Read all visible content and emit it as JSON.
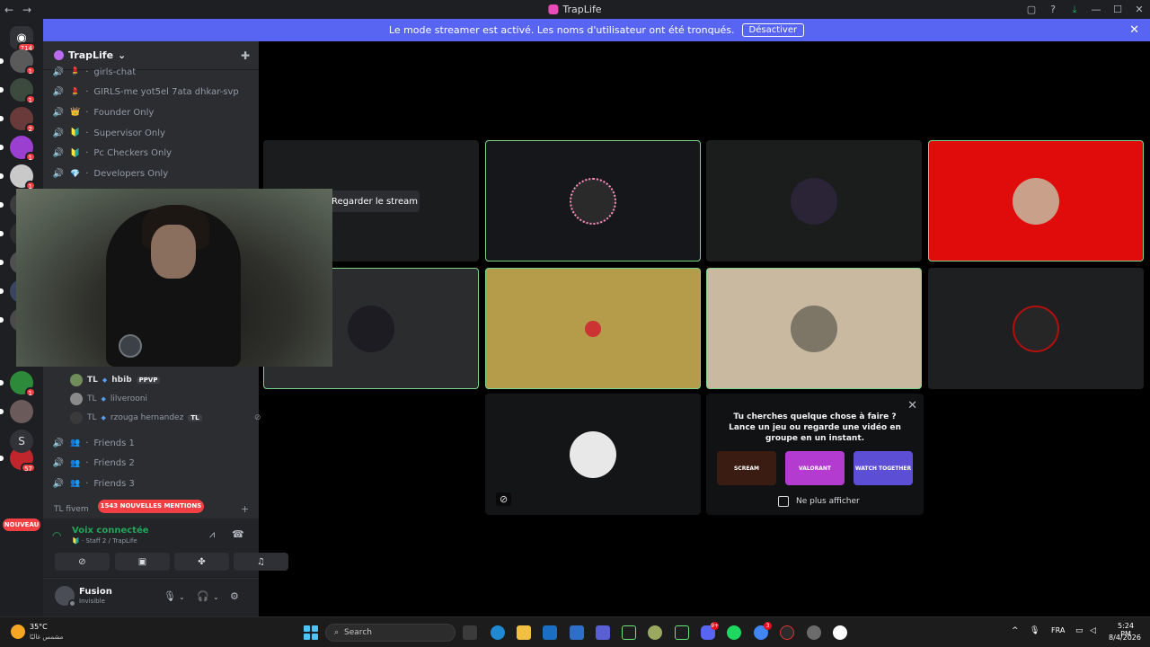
{
  "window": {
    "title": "TrapLife",
    "nav_back": "←",
    "nav_forward": "→",
    "buttons": [
      "▢",
      "?",
      "⤓",
      "—",
      "☐",
      "✕"
    ]
  },
  "banner": {
    "text": "Le mode streamer est activé. Les noms d'utilisateur ont été tronqués.",
    "button": "Désactiver",
    "close": "✕"
  },
  "rail": {
    "home_badge": "714",
    "servers": [
      {
        "badge": "1",
        "color": "#5a5a5a"
      },
      {
        "badge": "1",
        "color": "#3c4a3e"
      },
      {
        "badge": "2",
        "color": "#6a3a3a"
      },
      {
        "badge": "1",
        "color": "#9b3fd0"
      },
      {
        "badge": "1",
        "color": "#c9c9c9"
      },
      {
        "badge": "",
        "color": "#3d3d3d"
      },
      {
        "badge": "",
        "color": "#2f2f2f"
      },
      {
        "badge": "",
        "color": "#505050"
      },
      {
        "badge": "",
        "color": "#3a4660"
      },
      {
        "badge": "",
        "color": "#4b4b4b"
      },
      {
        "badge": "1",
        "color": "#2d8a3a"
      },
      {
        "badge": "",
        "color": "#6b5a5a"
      },
      {
        "badge": "57",
        "color": "#c0262c"
      }
    ],
    "letter_server": "S",
    "nouveau": "NOUVEAU"
  },
  "sidebar": {
    "server_name": "TrapLife",
    "chevron": "⌄",
    "add_member_icon": "✚",
    "channels_top": [
      {
        "emoji": "💄",
        "name": "girls-chat"
      },
      {
        "emoji": "💄",
        "name": "GIRLS-me yot5el 7ata dhkar-svp"
      },
      {
        "emoji": "👑",
        "name": "Founder Only"
      },
      {
        "emoji": "🔰",
        "name": "Supervisor Only"
      },
      {
        "emoji": "🔰",
        "name": "Pc Checkers Only"
      },
      {
        "emoji": "💎",
        "name": "Developers Only"
      }
    ],
    "members": [
      {
        "prefix": "TL",
        "name": "hbib",
        "pill": "PPVP",
        "muted": false,
        "highlight": true
      },
      {
        "prefix": "TL",
        "name": "lilverooni",
        "pill": "",
        "muted": false,
        "highlight": false
      },
      {
        "prefix": "TL",
        "name": "rzouga hernandez",
        "pill": "TL",
        "muted": true,
        "highlight": false
      }
    ],
    "channels_bottom": [
      {
        "emoji": "👥",
        "name": "Friends 1"
      },
      {
        "emoji": "👥",
        "name": "Friends 2"
      },
      {
        "emoji": "👥",
        "name": "Friends 3"
      }
    ],
    "category": "TL fivem",
    "mentions": "1543 NOUVELLES MENTIONS"
  },
  "voice": {
    "status": "Voix connectée",
    "channel": "Staff 2 / TrapLife"
  },
  "user": {
    "name": "Fusion",
    "status": "Invisible"
  },
  "stage": {
    "watch_stream": "Regarder le stream"
  },
  "activity": {
    "title_line1": "Tu cherches quelque chose à faire ?",
    "title_line2": "Lance un jeu ou regarde une vidéo en groupe en un instant.",
    "games": [
      {
        "label": "SCREAM",
        "color": "#3a1c12"
      },
      {
        "label": "VALORANT",
        "color": "#b43bd0"
      },
      {
        "label": "WATCH TOGETHER",
        "color": "#5c4fd6"
      }
    ],
    "checkbox_label": "Ne plus afficher"
  },
  "taskbar": {
    "temperature": "35°C",
    "condition": "مشمس غالبًا",
    "search": "Search",
    "language": "FRA",
    "time": "5:24 PM",
    "date": "8/4/2026",
    "discord_badge": "9+",
    "chrome_badge": "3"
  }
}
